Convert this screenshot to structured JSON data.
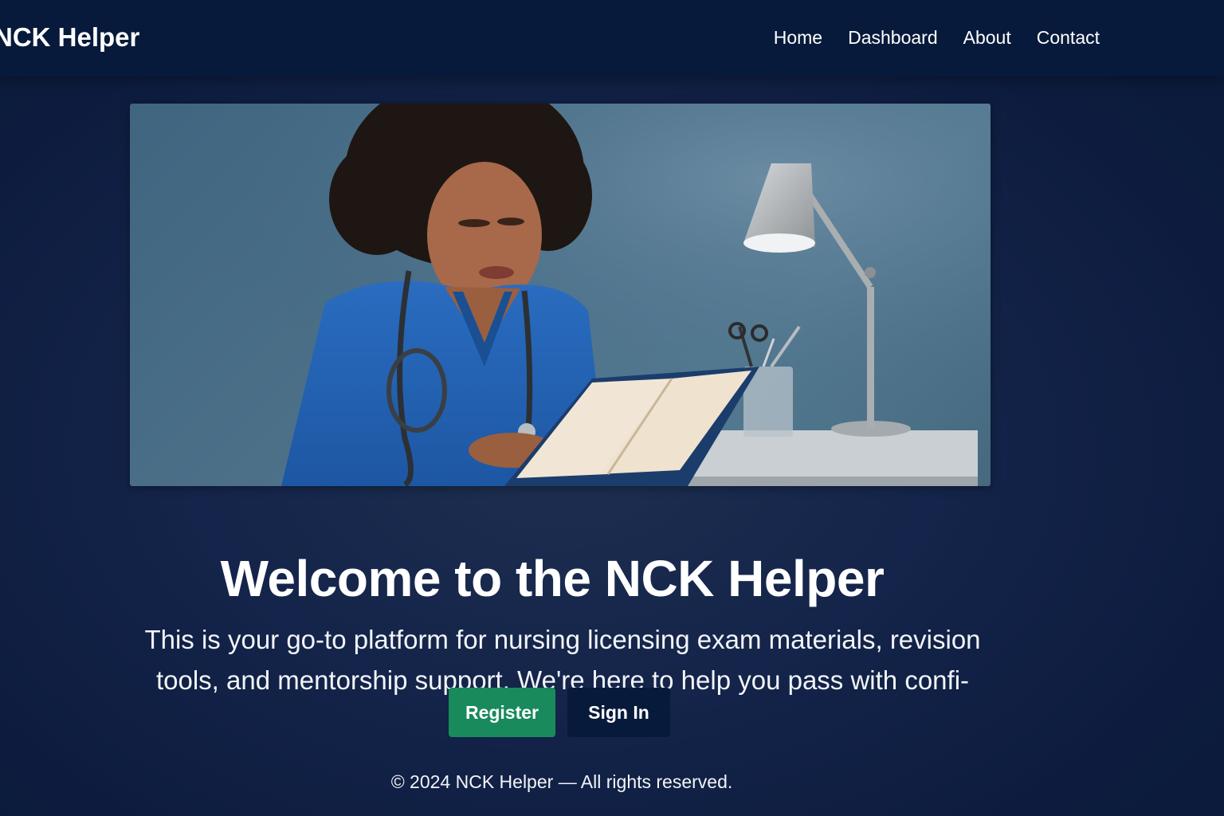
{
  "colors": {
    "background": "#0d1c3e",
    "navbar": "#081a3b",
    "register_button": "#198a5c",
    "signin_button": "#081a3b",
    "text": "#ffffff"
  },
  "navbar": {
    "brand": "NCK Helper",
    "links": [
      {
        "label": "Home"
      },
      {
        "label": "Dashboard"
      },
      {
        "label": "About"
      },
      {
        "label": "Contact"
      }
    ]
  },
  "hero": {
    "image_name": "nurse-reading-book-photo",
    "headline": "Welcome to the NCK Helper",
    "tagline": "This is your go-to platform for nursing licensing exam materials, revision tools, and mentorship support. We're here to help you pass with confi-"
  },
  "actions": {
    "register_label": "Register",
    "signin_label": "Sign In"
  },
  "footer": {
    "text": "© 2024 NCK Helper — All rights reserved."
  }
}
